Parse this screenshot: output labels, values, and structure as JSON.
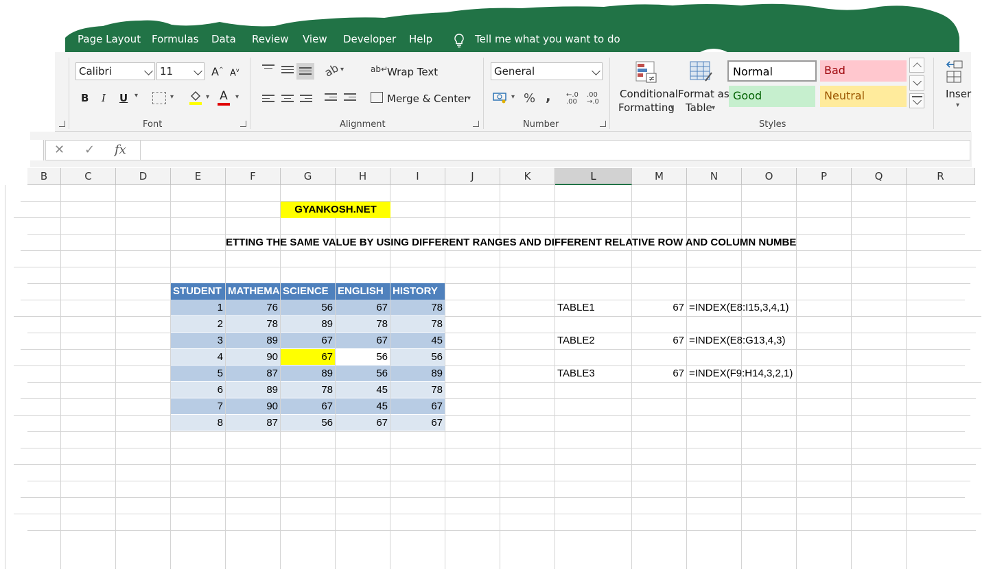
{
  "ribbon_tabs": [
    "Page Layout",
    "Formulas",
    "Data",
    "Review",
    "View",
    "Developer",
    "Help"
  ],
  "tell_me": "Tell me what you want to do",
  "font": {
    "name": "Calibri",
    "size": "11",
    "group_label": "Font",
    "bold": "B",
    "italic": "I",
    "underline": "U",
    "grow": "A",
    "shrink": "A",
    "color_letter": "A"
  },
  "alignment": {
    "wrap_text": "Wrap Text",
    "merge_center": "Merge & Center",
    "group_label": "Alignment"
  },
  "number": {
    "format": "General",
    "percent": "%",
    "comma": ",",
    "inc_decimal": "←.0 .00",
    "dec_decimal": ".00 →.0",
    "group_label": "Number"
  },
  "styles": {
    "conditional": [
      "Conditional",
      "Formatting"
    ],
    "format_as_table": [
      "Format as",
      "Table"
    ],
    "normal": "Normal",
    "bad": "Bad",
    "good": "Good",
    "neutral": "Neutral",
    "group_label": "Styles",
    "colors": {
      "bad_bg": "#ffc7ce",
      "bad_fg": "#9c0006",
      "good_bg": "#c6efce",
      "good_fg": "#006100",
      "neutral_bg": "#ffeb9c",
      "neutral_fg": "#9c5700"
    }
  },
  "insert_label": "Inser",
  "formula_bar": {
    "cancel": "✕",
    "enter": "✓",
    "fx": "fx",
    "value": ""
  },
  "columns": [
    "B",
    "C",
    "D",
    "E",
    "F",
    "G",
    "H",
    "I",
    "J",
    "K",
    "L",
    "M",
    "N",
    "O",
    "P",
    "Q",
    "R"
  ],
  "selected_column": "L",
  "sheet": {
    "brand": "GYANKOSH.NET",
    "title": "ETTING THE SAME VALUE BY USING DIFFERENT RANGES AND DIFFERENT RELATIVE ROW AND COLUMN NUMBE",
    "table_headers": [
      "STUDENT",
      "MATHEMA",
      "SCIENCE",
      "ENGLISH",
      "HISTORY"
    ],
    "table_rows": [
      [
        "1",
        "76",
        "56",
        "67",
        "78"
      ],
      [
        "2",
        "78",
        "89",
        "78",
        "78"
      ],
      [
        "3",
        "89",
        "67",
        "67",
        "45"
      ],
      [
        "4",
        "90",
        "67",
        "56",
        "56"
      ],
      [
        "5",
        "87",
        "89",
        "56",
        "89"
      ],
      [
        "6",
        "89",
        "78",
        "45",
        "78"
      ],
      [
        "7",
        "90",
        "67",
        "45",
        "67"
      ],
      [
        "8",
        "87",
        "56",
        "67",
        "67"
      ]
    ],
    "results": [
      {
        "label": "TABLE1",
        "value": "67",
        "formula": "=INDEX(E8:I15,3,4,1)"
      },
      {
        "label": "TABLE2",
        "value": "67",
        "formula": "=INDEX(E8:G13,4,3)"
      },
      {
        "label": "TABLE3",
        "value": "67",
        "formula": "=INDEX(F9:H14,3,2,1)"
      }
    ]
  },
  "colors": {
    "excel_green": "#217346",
    "table_header": "#4f81bd",
    "band_dark": "#b8cce4",
    "band_light": "#dce6f1",
    "highlight": "#ffff00"
  }
}
